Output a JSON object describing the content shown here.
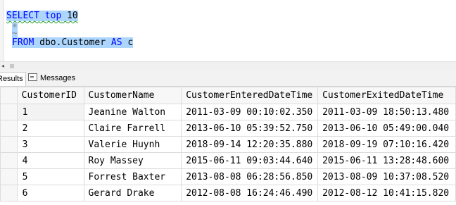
{
  "editor": {
    "line1_kw": "SELECT",
    "line1_top": "top",
    "line1_num": "10",
    "line2_star": "*",
    "line3_tilde": "~",
    "line4_kw": "FROM",
    "line4_table": "dbo.Customer",
    "line4_as": "AS",
    "line4_alias": "c"
  },
  "tabs": {
    "results": "Results",
    "messages": "Messages"
  },
  "grid": {
    "columns": [
      "CustomerID",
      "CustomerName",
      "CustomerEnteredDateTime",
      "CustomerExitedDateTime"
    ],
    "rows": [
      [
        "1",
        "Jeanine Walton",
        "2011-03-09 00:10:02.350",
        "2011-03-09 18:50:13.480"
      ],
      [
        "2",
        "Claire Farrell",
        "2013-06-10 05:39:52.750",
        "2013-06-10 05:49:00.040"
      ],
      [
        "3",
        "Valerie Huynh",
        "2018-09-14 12:20:35.880",
        "2018-09-19 07:10:16.420"
      ],
      [
        "4",
        "Roy Massey",
        "2015-06-11 09:03:44.640",
        "2015-06-11 13:28:48.600"
      ],
      [
        "5",
        "Forrest Baxter",
        "2013-08-08 06:28:56.850",
        "2013-08-09 10:37:08.520"
      ],
      [
        "6",
        "Gerard Drake",
        "2012-08-08 16:24:46.490",
        "2012-08-12 10:41:15.820"
      ]
    ]
  },
  "colors": {
    "selection": "#add6ff",
    "keyword": "#0000ff",
    "operator": "#808080"
  },
  "icons": {
    "messages_tab": "messages-icon",
    "scroll_left": "scroll-left-arrow-icon"
  }
}
